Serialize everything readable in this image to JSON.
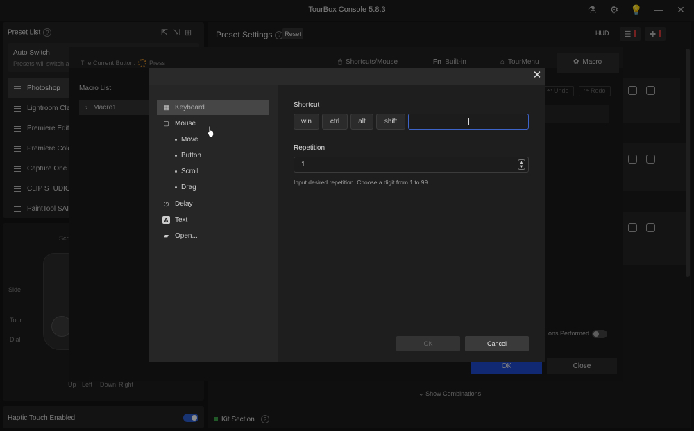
{
  "window": {
    "title": "TourBox Console 5.8.3"
  },
  "left": {
    "preset_list_label": "Preset List",
    "help": "?",
    "auto_switch_title": "Auto Switch",
    "auto_switch_desc": "Presets will switch a",
    "presets": [
      "Photoshop",
      "Lightroom Clas",
      "Premiere Editi",
      "Premiere Color",
      "Capture One",
      "CLIP STUDIO P",
      "PaintTool SAI 1"
    ],
    "device_labels": {
      "scroll": "Scr",
      "side": "Side",
      "tour": "Tour",
      "dial": "Dial",
      "up": "Up",
      "left": "Left",
      "down": "Down",
      "right": "Right"
    },
    "haptic_label": "Haptic Touch Enabled"
  },
  "right": {
    "preset_settings": "Preset Settings",
    "reset": "Reset",
    "hud": "HUD",
    "tabs": [
      "Shortcuts/Mouse",
      "Built-in",
      "TourMenu",
      "Macro"
    ],
    "undo": "Undo",
    "redo": "Redo",
    "show_combinations": "Show Combinations",
    "kit_section": "Kit Section"
  },
  "macro_bg": {
    "current_button": "The Current Button:",
    "press": "Press",
    "macro_list_title": "Macro List",
    "macro_items": [
      "Macro1"
    ],
    "performed": "ons Performed",
    "ok": "OK",
    "close": "Close"
  },
  "dialog": {
    "actions": {
      "keyboard": "Keyboard",
      "mouse": "Mouse",
      "move": "Move",
      "button": "Button",
      "scroll": "Scroll",
      "drag": "Drag",
      "delay": "Delay",
      "text": "Text",
      "open": "Open..."
    },
    "shortcut_label": "Shortcut",
    "keys": [
      "win",
      "ctrl",
      "alt",
      "shift"
    ],
    "shortcut_value": "",
    "repetition_label": "Repetition",
    "repetition_value": "1",
    "hint": "Input desired repetition. Choose a digit from 1 to 99.",
    "ok": "OK",
    "cancel": "Cancel"
  },
  "colors": {
    "accent": "#1f4ad0",
    "input_focus": "#3d64c9",
    "alert": "#d63c3c",
    "kit_dot": "#3fa24a"
  }
}
